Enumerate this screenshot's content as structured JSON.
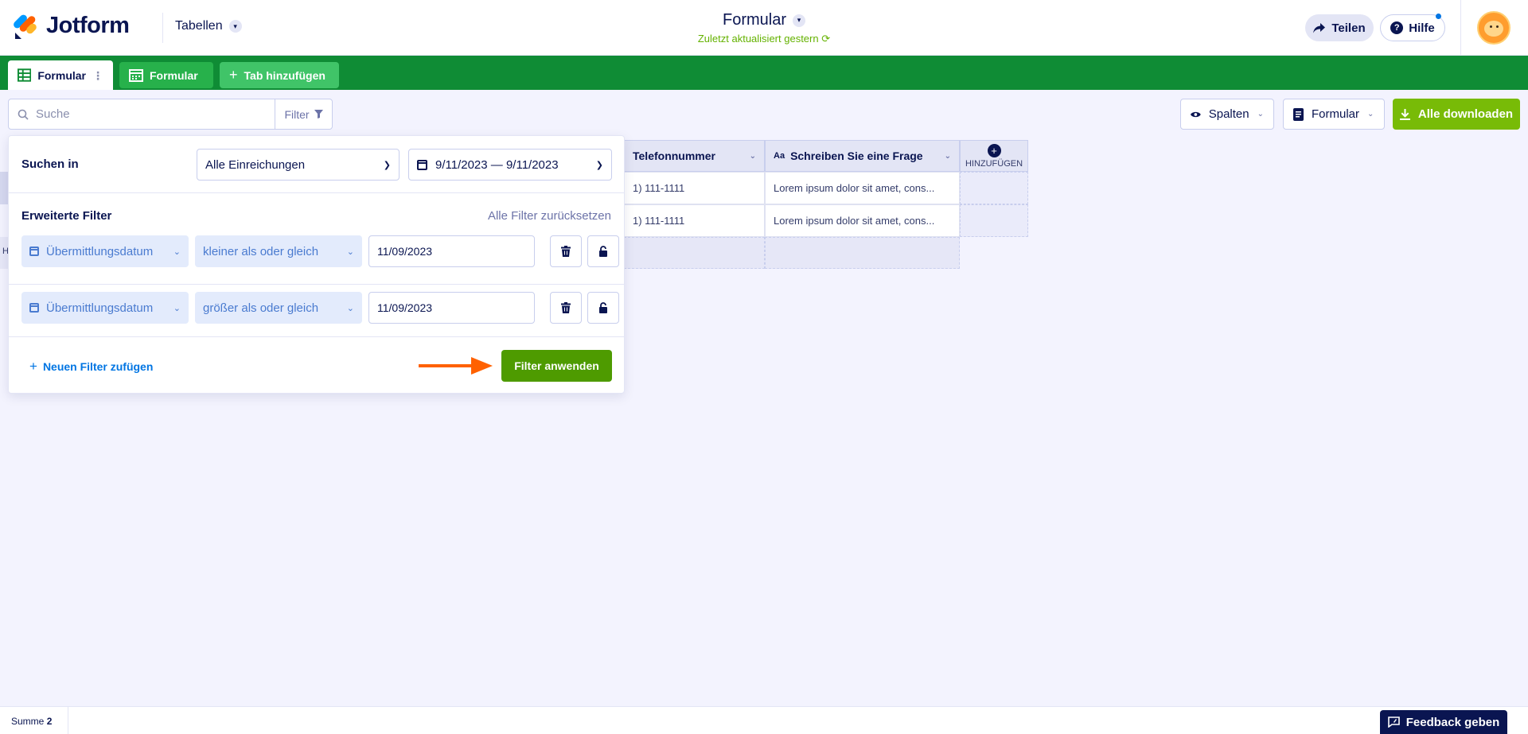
{
  "header": {
    "logo_text": "Jotform",
    "app_switcher": "Tabellen",
    "form_title": "Formular",
    "last_updated": "Zuletzt aktualisiert gestern",
    "share_label": "Teilen",
    "help_label": "Hilfe"
  },
  "tabs": [
    {
      "label": "Formular",
      "active": true
    },
    {
      "label": "Formular",
      "active": false
    },
    {
      "label": "Tab hinzufügen"
    }
  ],
  "toolbar": {
    "search_placeholder": "Suche",
    "filter_label": "Filter",
    "columns_label": "Spalten",
    "form_label": "Formular",
    "download_label": "Alle downloaden"
  },
  "table": {
    "columns": [
      {
        "label": "Telefonnummer"
      },
      {
        "label": "Schreiben Sie eine Frage",
        "type_icon": "Aa"
      },
      {
        "label": "HINZUFÜGEN"
      }
    ],
    "rows": [
      {
        "phone": "1) 111-1111",
        "question": "Lorem ipsum dolor sit amet, cons..."
      },
      {
        "phone": "1) 111-1111",
        "question": "Lorem ipsum dolor sit amet, cons..."
      }
    ],
    "partial_left_text": "H"
  },
  "filter_panel": {
    "search_in_label": "Suchen in",
    "search_in_value": "Alle Einreichungen",
    "date_range": "9/11/2023 — 9/11/2023",
    "advanced_label": "Erweiterte Filter",
    "reset_label": "Alle Filter zurücksetzen",
    "filters": [
      {
        "field": "Übermittlungsdatum",
        "operator": "kleiner als oder gleich",
        "value": "11/09/2023"
      },
      {
        "field": "Übermittlungsdatum",
        "operator": "größer als oder gleich",
        "value": "11/09/2023"
      }
    ],
    "add_filter_label": "Neuen Filter zufügen",
    "apply_label": "Filter anwenden"
  },
  "footer": {
    "sum_label": "Summe",
    "sum_value": "2",
    "feedback_label": "Feedback geben"
  },
  "colors": {
    "brand_navy": "#0a1551",
    "tab_green": "#0f8c35",
    "download_green": "#78bb07",
    "apply_green": "#4e9b00",
    "arrow_orange": "#ff6100"
  }
}
